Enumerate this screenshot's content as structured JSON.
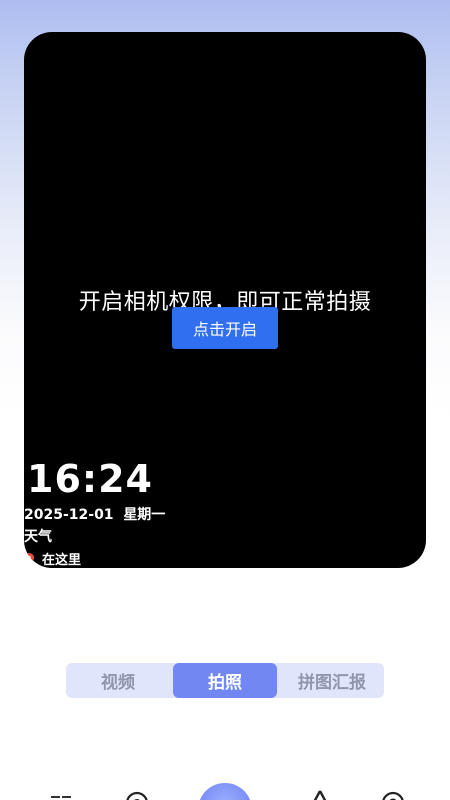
{
  "camera": {
    "permission_message": "开启相机权限，即可正常拍摄",
    "enable_button_label": "点击开启"
  },
  "watermark": {
    "time": "16:24",
    "date": "2025-12-01",
    "weekday": "星期一",
    "weather": "天气",
    "location": "在这里"
  },
  "modes": {
    "tabs": [
      {
        "label": "视频"
      },
      {
        "label": "拍照"
      },
      {
        "label": "拼图汇报"
      }
    ],
    "active_index": 1
  },
  "bottom_nav": {
    "items": [
      "album-icon",
      "compass-icon",
      "shutter-button",
      "up-arrow-icon",
      "settings-icon"
    ]
  },
  "colors": {
    "accent": "#2f6ff0",
    "tab_active": "#7387f3",
    "tab_bar": "#e1e5fb"
  }
}
